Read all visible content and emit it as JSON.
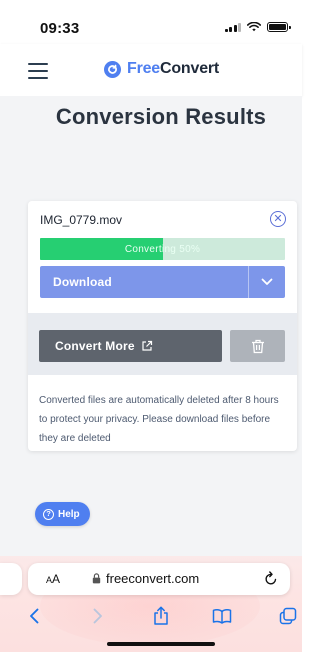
{
  "status": {
    "time": "09:33"
  },
  "header": {
    "brand_free": "Free",
    "brand_convert": "Convert",
    "logo_icon": "freeconvert-logo-icon",
    "menu_icon": "hamburger-menu-icon"
  },
  "page": {
    "title": "Conversion Results"
  },
  "file": {
    "name": "IMG_0779.mov",
    "progress_label": "Converting 50%",
    "progress_fraction": 0.5
  },
  "actions": {
    "download_label": "Download",
    "convert_more_label": "Convert More",
    "delete_icon": "trash-icon"
  },
  "notice": {
    "text": "Converted files are automatically deleted after 8 hours to protect your privacy. Please download files before they are deleted"
  },
  "help": {
    "label": "Help"
  },
  "browser": {
    "aa_label_small": "A",
    "aa_label_big": "A",
    "url": "freeconvert.com"
  },
  "colors": {
    "brand_blue": "#4f7ff0",
    "progress_green": "#26cf72",
    "progress_track": "#cdeadb",
    "download_blue": "#7d96ea",
    "convert_more_gray": "#5e646d",
    "delete_gray": "#aeb3ba"
  }
}
